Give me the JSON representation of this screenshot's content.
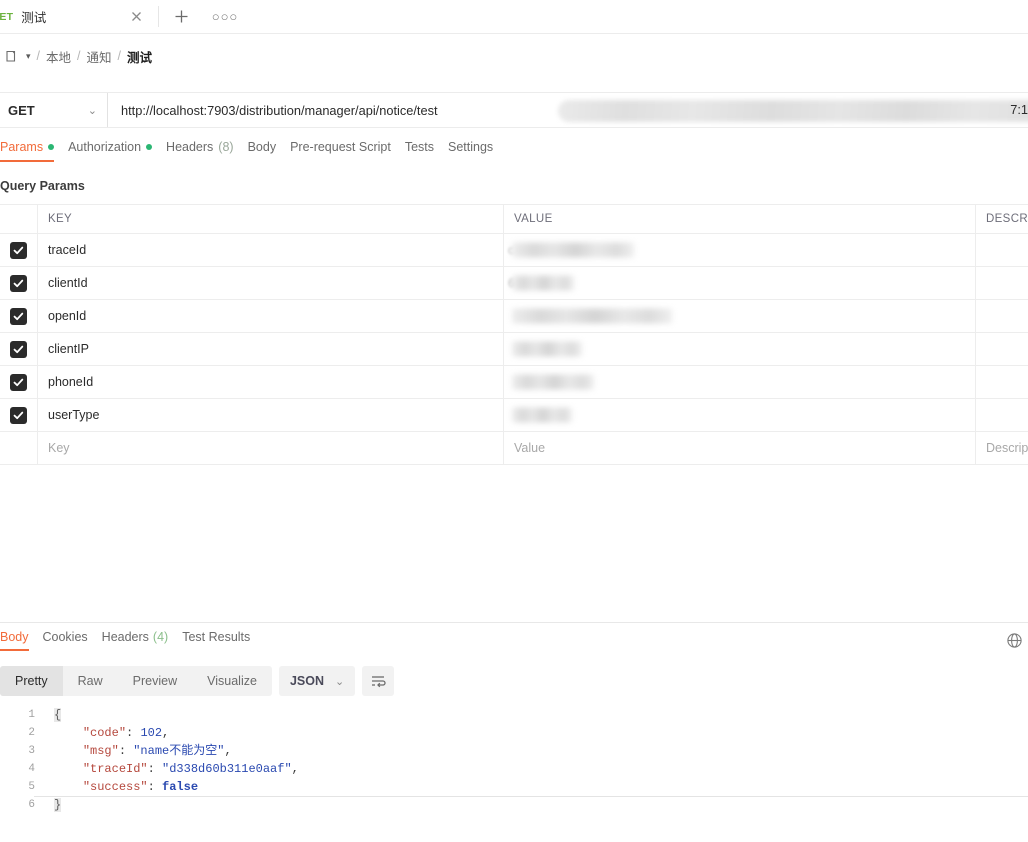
{
  "tabstrip": {
    "tab": {
      "method": "GET",
      "title": "测试"
    },
    "close_icon": "close-icon",
    "new_tab_icon": "plus-icon",
    "more_label": "○○○"
  },
  "breadcrumb": {
    "folder_icon": "folder-icon",
    "caret": "▾",
    "items": [
      "本地",
      "通知",
      "测试"
    ],
    "separator": "/"
  },
  "urlbar": {
    "method": "GET",
    "method_caret": "⌄",
    "url_visible": "http://localhost:7903/distribution/manager/api/notice/test",
    "url_tail": "7:1",
    "url_redacted": true
  },
  "request_tabs": [
    {
      "label": "Params",
      "dot": true,
      "count": "",
      "active": true
    },
    {
      "label": "Authorization",
      "dot": true,
      "count": "",
      "active": false
    },
    {
      "label": "Headers",
      "dot": false,
      "count": "(8)",
      "active": false
    },
    {
      "label": "Body",
      "dot": false,
      "count": "",
      "active": false
    },
    {
      "label": "Pre-request Script",
      "dot": false,
      "count": "",
      "active": false
    },
    {
      "label": "Tests",
      "dot": false,
      "count": "",
      "active": false
    },
    {
      "label": "Settings",
      "dot": false,
      "count": "",
      "active": false
    }
  ],
  "query_params": {
    "section_title": "Query Params",
    "columns": {
      "key": "KEY",
      "value": "VALUE",
      "description": "DESCRI"
    },
    "rows": [
      {
        "checked": true,
        "key": "traceId",
        "value": "",
        "value_redacted": "w1",
        "value_hint": "c",
        "description": ""
      },
      {
        "checked": true,
        "key": "clientId",
        "value": "",
        "value_redacted": "w2",
        "value_hint": "6",
        "description": ""
      },
      {
        "checked": true,
        "key": "openId",
        "value": "",
        "value_redacted": "w3",
        "value_hint": "",
        "description": ""
      },
      {
        "checked": true,
        "key": "clientIP",
        "value": "",
        "value_redacted": "w4",
        "value_hint": "",
        "description": ""
      },
      {
        "checked": true,
        "key": "phoneId",
        "value": "",
        "value_redacted": "w5",
        "value_hint": "",
        "description": ""
      },
      {
        "checked": true,
        "key": "userType",
        "value": "",
        "value_redacted": "w6",
        "value_hint": "",
        "description": ""
      }
    ],
    "placeholder_row": {
      "key": "Key",
      "value": "Value",
      "description": "Descrip"
    }
  },
  "response": {
    "tabs": [
      {
        "label": "Body",
        "count": "",
        "active": true
      },
      {
        "label": "Cookies",
        "count": "",
        "active": false
      },
      {
        "label": "Headers",
        "count": "(4)",
        "active": false
      },
      {
        "label": "Test Results",
        "count": "",
        "active": false
      }
    ],
    "globe_icon": "globe-icon",
    "view_modes": [
      {
        "label": "Pretty",
        "active": true
      },
      {
        "label": "Raw",
        "active": false
      },
      {
        "label": "Preview",
        "active": false
      },
      {
        "label": "Visualize",
        "active": false
      }
    ],
    "format": "JSON",
    "format_caret": "⌄",
    "wrap_icon": "wrap-lines-icon",
    "line_numbers": [
      "1",
      "2",
      "3",
      "4",
      "5",
      "6"
    ],
    "body": {
      "open_brace": "{",
      "close_brace": "}",
      "fields": [
        {
          "key": "\"code\"",
          "sep": ": ",
          "value": "102",
          "type": "num",
          "comma": ","
        },
        {
          "key": "\"msg\"",
          "sep": ": ",
          "value": "\"name不能为空\"",
          "type": "str",
          "comma": ","
        },
        {
          "key": "\"traceId\"",
          "sep": ": ",
          "value": "\"d338d60b311e0aaf\"",
          "type": "str",
          "comma": ","
        },
        {
          "key": "\"success\"",
          "sep": ": ",
          "value": "false",
          "type": "bool",
          "comma": ""
        }
      ]
    }
  },
  "colors": {
    "accent": "#f26b3a",
    "green_dot": "#2bb673",
    "method_green": "#6cb33f",
    "json_string": "#2a49b0",
    "json_key": "#b5483d"
  }
}
